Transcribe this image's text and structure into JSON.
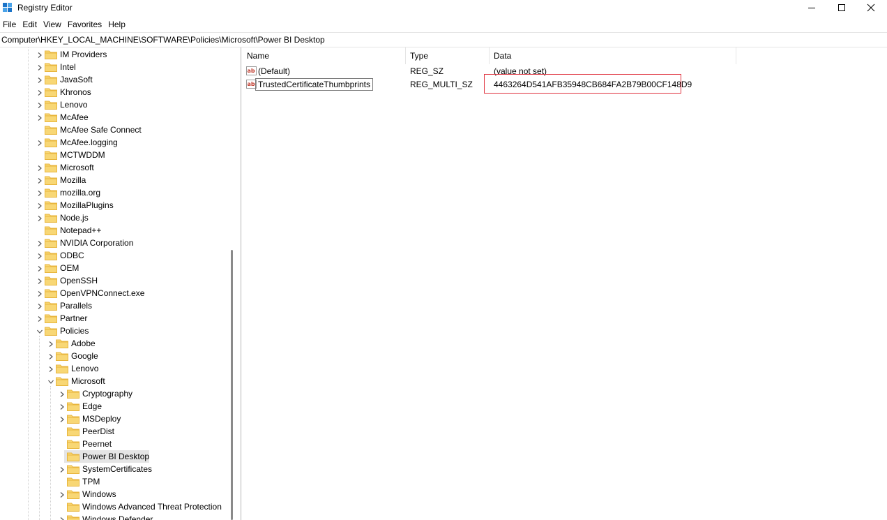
{
  "window": {
    "title": "Registry Editor"
  },
  "menu": [
    "File",
    "Edit",
    "View",
    "Favorites",
    "Help"
  ],
  "address": "Computer\\HKEY_LOCAL_MACHINE\\SOFTWARE\\Policies\\Microsoft\\Power BI Desktop",
  "tree": [
    {
      "label": "IM Providers",
      "level": 0,
      "expander": "collapsed"
    },
    {
      "label": "Intel",
      "level": 0,
      "expander": "collapsed"
    },
    {
      "label": "JavaSoft",
      "level": 0,
      "expander": "collapsed"
    },
    {
      "label": "Khronos",
      "level": 0,
      "expander": "collapsed"
    },
    {
      "label": "Lenovo",
      "level": 0,
      "expander": "collapsed"
    },
    {
      "label": "McAfee",
      "level": 0,
      "expander": "collapsed"
    },
    {
      "label": "McAfee Safe Connect",
      "level": 0,
      "expander": "none"
    },
    {
      "label": "McAfee.logging",
      "level": 0,
      "expander": "collapsed"
    },
    {
      "label": "MCTWDDM",
      "level": 0,
      "expander": "none"
    },
    {
      "label": "Microsoft",
      "level": 0,
      "expander": "collapsed"
    },
    {
      "label": "Mozilla",
      "level": 0,
      "expander": "collapsed"
    },
    {
      "label": "mozilla.org",
      "level": 0,
      "expander": "collapsed"
    },
    {
      "label": "MozillaPlugins",
      "level": 0,
      "expander": "collapsed"
    },
    {
      "label": "Node.js",
      "level": 0,
      "expander": "collapsed"
    },
    {
      "label": "Notepad++",
      "level": 0,
      "expander": "none"
    },
    {
      "label": "NVIDIA Corporation",
      "level": 0,
      "expander": "collapsed"
    },
    {
      "label": "ODBC",
      "level": 0,
      "expander": "collapsed"
    },
    {
      "label": "OEM",
      "level": 0,
      "expander": "collapsed"
    },
    {
      "label": "OpenSSH",
      "level": 0,
      "expander": "collapsed"
    },
    {
      "label": "OpenVPNConnect.exe",
      "level": 0,
      "expander": "collapsed"
    },
    {
      "label": "Parallels",
      "level": 0,
      "expander": "collapsed"
    },
    {
      "label": "Partner",
      "level": 0,
      "expander": "collapsed"
    },
    {
      "label": "Policies",
      "level": 0,
      "expander": "expanded"
    },
    {
      "label": "Adobe",
      "level": 1,
      "expander": "collapsed"
    },
    {
      "label": "Google",
      "level": 1,
      "expander": "collapsed"
    },
    {
      "label": "Lenovo",
      "level": 1,
      "expander": "collapsed"
    },
    {
      "label": "Microsoft",
      "level": 1,
      "expander": "expanded"
    },
    {
      "label": "Cryptography",
      "level": 2,
      "expander": "collapsed"
    },
    {
      "label": "Edge",
      "level": 2,
      "expander": "collapsed"
    },
    {
      "label": "MSDeploy",
      "level": 2,
      "expander": "collapsed"
    },
    {
      "label": "PeerDist",
      "level": 2,
      "expander": "none"
    },
    {
      "label": "Peernet",
      "level": 2,
      "expander": "none"
    },
    {
      "label": "Power BI Desktop",
      "level": 2,
      "expander": "none",
      "selected": true
    },
    {
      "label": "SystemCertificates",
      "level": 2,
      "expander": "collapsed"
    },
    {
      "label": "TPM",
      "level": 2,
      "expander": "none"
    },
    {
      "label": "Windows",
      "level": 2,
      "expander": "collapsed"
    },
    {
      "label": "Windows Advanced Threat Protection",
      "level": 2,
      "expander": "none"
    },
    {
      "label": "Windows Defender",
      "level": 2,
      "expander": "collapsed"
    }
  ],
  "columns": {
    "name": "Name",
    "type": "Type",
    "data": "Data"
  },
  "values": [
    {
      "name": "(Default)",
      "type": "REG_SZ",
      "data": "(value not set)"
    },
    {
      "name": "TrustedCertificateThumbprints",
      "type": "REG_MULTI_SZ",
      "data": "4463264D541AFB35948CB684FA2B79B00CF148D9"
    }
  ],
  "colors": {
    "folder": "#f8d775",
    "folder_dark": "#e8b53c",
    "highlight": "#e0313d",
    "selection": "#e5e5e5"
  },
  "icons": {
    "app": "registry-icon",
    "value": "string-value-icon"
  }
}
